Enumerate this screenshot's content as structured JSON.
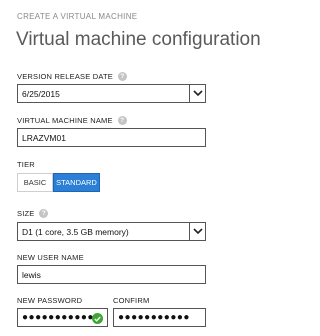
{
  "header": {
    "eyebrow": "CREATE A VIRTUAL MACHINE",
    "title": "Virtual machine configuration"
  },
  "version": {
    "label": "VERSION RELEASE DATE",
    "value": "6/25/2015"
  },
  "vm_name": {
    "label": "VIRTUAL MACHINE NAME",
    "value": "LRAZVM01"
  },
  "tier": {
    "label": "TIER",
    "options": [
      "BASIC",
      "STANDARD"
    ],
    "selected": "STANDARD"
  },
  "size": {
    "label": "SIZE",
    "value": "D1 (1 core, 3.5 GB memory)"
  },
  "user": {
    "label": "NEW USER NAME",
    "value": "lewis"
  },
  "password": {
    "label": "NEW PASSWORD",
    "value": "●●●●●●●●●●●",
    "valid": true
  },
  "confirm": {
    "label": "CONFIRM",
    "value": "●●●●●●●●●●●"
  },
  "colors": {
    "accent": "#2c7fd6",
    "valid": "#3fa535"
  },
  "icons": {
    "help": "?",
    "dropdown": "chevron-down-icon",
    "valid": "checkmark-icon"
  }
}
